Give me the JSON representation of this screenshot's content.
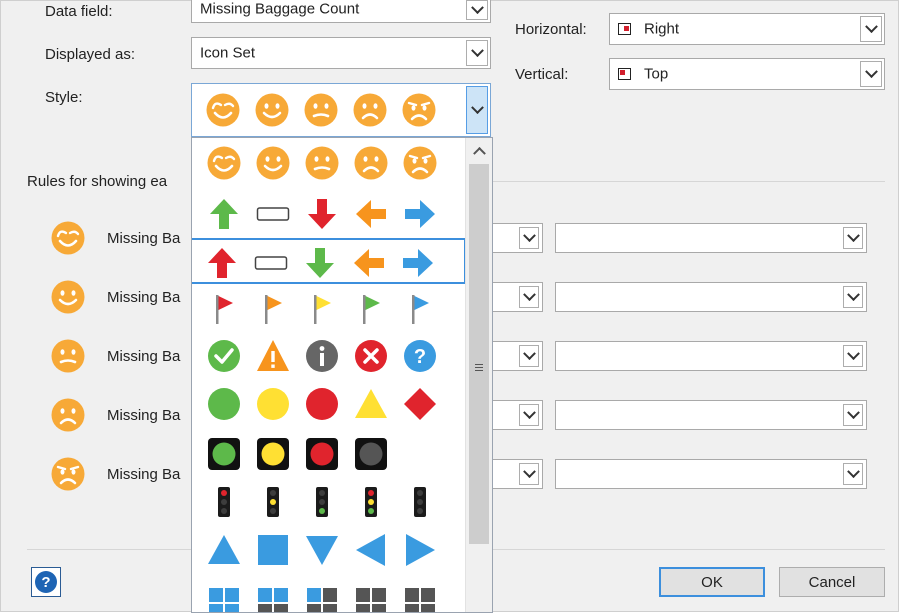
{
  "dialog": {
    "data_field_label": "Data field:",
    "data_field_value": "Missing Baggage Count",
    "displayed_as_label": "Displayed as:",
    "displayed_as_value": "Icon Set",
    "style_label": "Style:",
    "horizontal_label": "Horizontal:",
    "horizontal_value": "Right",
    "vertical_label": "Vertical:",
    "vertical_value": "Top",
    "rules_label": "Rules for showing ea",
    "ok_label": "OK",
    "cancel_label": "Cancel",
    "help_icon": "?"
  },
  "rules": [
    {
      "icon": "smile-wink-icon",
      "label": "Missing Ba"
    },
    {
      "icon": "smile-icon",
      "label": "Missing Ba"
    },
    {
      "icon": "neutral-face-icon",
      "label": "Missing Ba"
    },
    {
      "icon": "sad-face-icon",
      "label": "Missing Ba"
    },
    {
      "icon": "very-sad-face-icon",
      "label": "Missing Ba"
    }
  ],
  "icon_sets": [
    {
      "name": "faces",
      "icons": [
        "smile-wink-icon",
        "smile-icon",
        "neutral-face-icon",
        "sad-face-icon",
        "very-sad-face-icon"
      ]
    },
    {
      "name": "arrows-green-up",
      "icons": [
        "arrow-up-green-icon",
        "rectangle-icon",
        "arrow-down-red-icon",
        "arrow-left-orange-icon",
        "arrow-right-blue-icon"
      ]
    },
    {
      "name": "arrows-red-up",
      "icons": [
        "arrow-up-red-icon",
        "rectangle-icon",
        "arrow-down-green-icon",
        "arrow-left-orange-icon",
        "arrow-right-blue-icon"
      ],
      "selected": true
    },
    {
      "name": "flags",
      "icons": [
        "flag-red-icon",
        "flag-orange-icon",
        "flag-yellow-icon",
        "flag-green-icon",
        "flag-blue-icon"
      ]
    },
    {
      "name": "symbols",
      "icons": [
        "check-circle-icon",
        "warning-triangle-icon",
        "info-circle-icon",
        "x-circle-icon",
        "question-circle-icon"
      ]
    },
    {
      "name": "shapes",
      "icons": [
        "green-circle-icon",
        "yellow-circle-icon",
        "red-circle-icon",
        "yellow-triangle-icon",
        "red-diamond-icon"
      ]
    },
    {
      "name": "traffic-lights",
      "icons": [
        "light-green-icon",
        "light-yellow-icon",
        "light-red-icon",
        "light-gray-icon"
      ]
    },
    {
      "name": "traffic-signals",
      "icons": [
        "signal-red-icon",
        "signal-yellow-icon",
        "signal-green-icon",
        "signal-multi-icon",
        "signal-off-icon"
      ]
    },
    {
      "name": "blue-shapes",
      "icons": [
        "triangle-up-blue-icon",
        "square-blue-icon",
        "triangle-down-blue-icon",
        "triangle-left-blue-icon",
        "triangle-right-blue-icon"
      ]
    },
    {
      "name": "quarters",
      "icons": [
        "quarters-1-icon",
        "quarters-2-icon",
        "quarters-3-icon",
        "quarters-4-icon",
        "quarters-5-icon"
      ]
    }
  ],
  "colors": {
    "face_orange": "#f7a937",
    "accent_blue": "#3c8fdd",
    "green": "#5db94a",
    "red": "#e0242d",
    "orange": "#f7941d",
    "blue": "#3a9be0",
    "yellow": "#ffe033",
    "gray": "#666666"
  }
}
